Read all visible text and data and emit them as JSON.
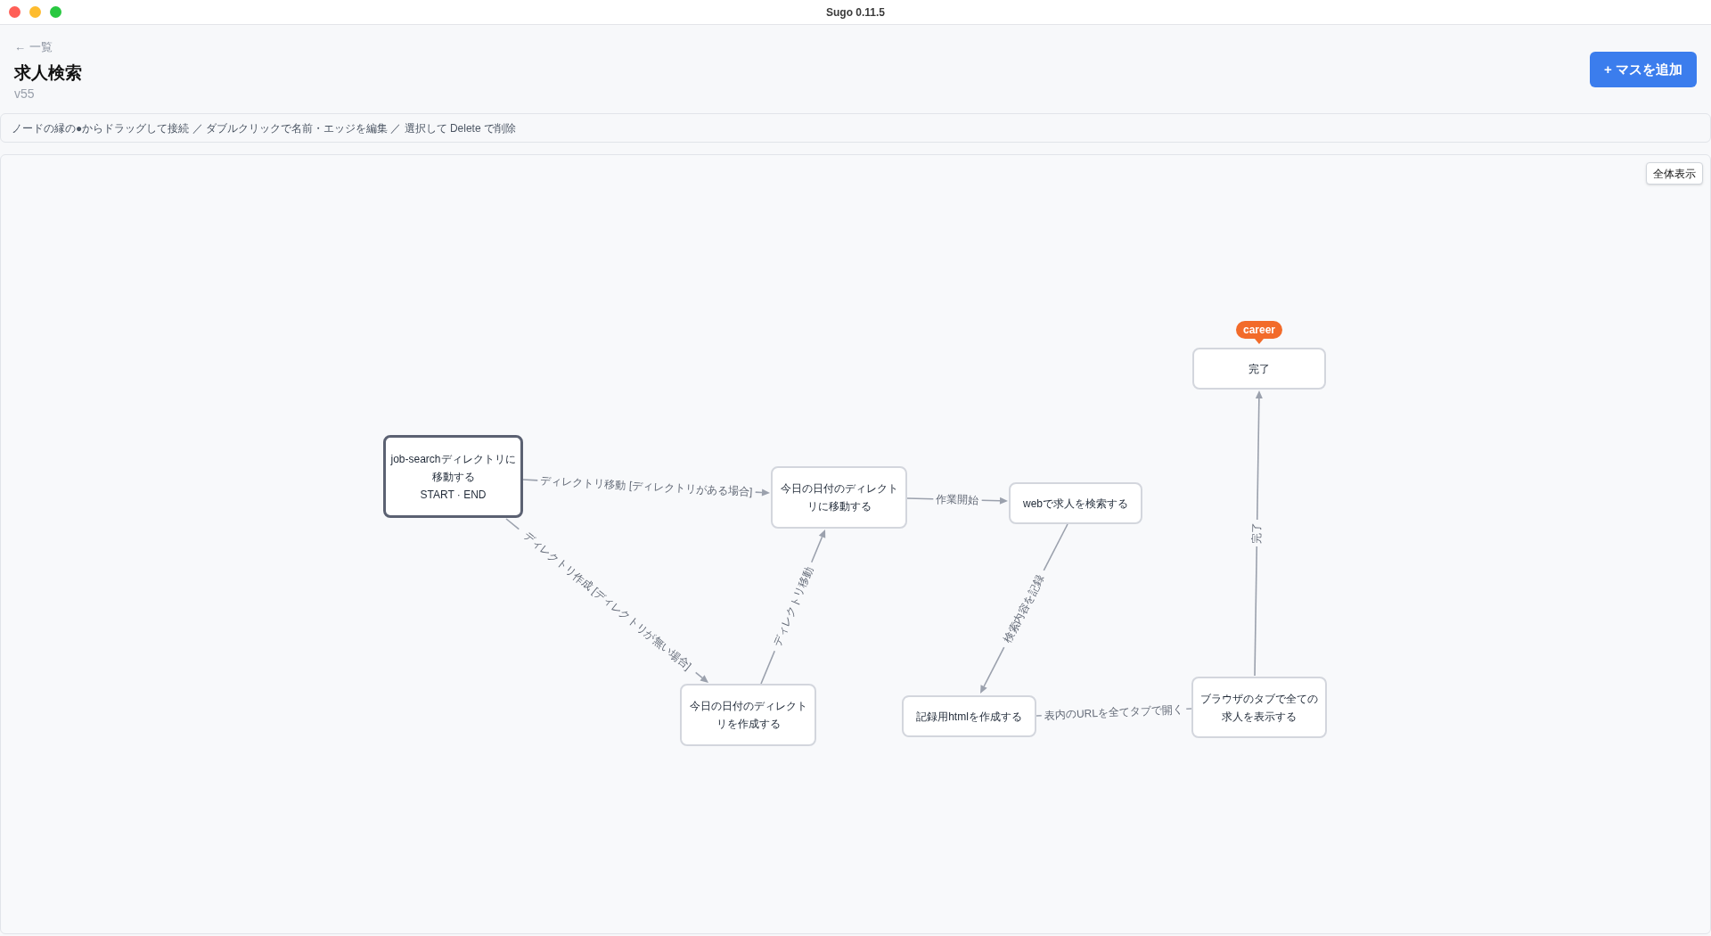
{
  "window": {
    "title": "Sugo 0.11.5"
  },
  "header": {
    "back_link": "← 一覧",
    "title": "求人検索",
    "version": "v55",
    "add_button": "+ マスを追加"
  },
  "hint_bar": "ノードの縁の●からドラッグして接続 ／ ダブルクリックで名前・エッジを編集 ／ 選択して Delete で削除",
  "canvas": {
    "fit_button": "全体表示",
    "nodes": [
      {
        "label": "完了",
        "kind": "step",
        "tag": "career"
      },
      {
        "label": "job-searchディレクトリに移動する",
        "kind": "start",
        "role": "START · END"
      },
      {
        "label": "今日の日付のディレクトリに移動する",
        "kind": "step"
      },
      {
        "label": "webで求人を検索する",
        "kind": "step"
      },
      {
        "label": "今日の日付のディレクトリを作成する",
        "kind": "step"
      },
      {
        "label": "記録用htmlを作成する",
        "kind": "step"
      },
      {
        "label": "ブラウザのタブで全ての求人を表示する",
        "kind": "step"
      }
    ],
    "edges": [
      {
        "label": "ディレクトリ移動 [ディレクトリがある場合]",
        "arrowhead": true
      },
      {
        "label": "ディレクトリ作成 [ディレクトリが無い場合]",
        "arrowhead": true
      },
      {
        "label": "ディレクトリ移動",
        "arrowhead": true
      },
      {
        "label": "作業開始",
        "arrowhead": true
      },
      {
        "label": "検索内容を記録",
        "arrowhead": true
      },
      {
        "label": "表内のURLを全てタブで開く",
        "arrowhead": false
      },
      {
        "label": "完了",
        "arrowhead": true
      }
    ]
  }
}
